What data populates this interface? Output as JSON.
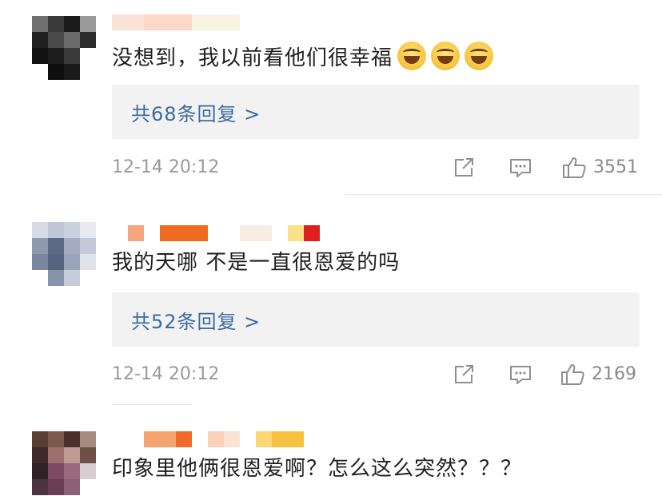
{
  "comments": [
    {
      "text": "没想到，我以前看他们很幸福",
      "emoji_icons": [
        "laughing-tears-icon",
        "laughing-tears-icon",
        "laughing-tears-icon"
      ],
      "replies_label": "共68条回复 >",
      "time": "12-14 20:12",
      "likes": "3551"
    },
    {
      "text": "我的天哪 不是一直很恩爱的吗",
      "emoji_icons": [],
      "replies_label": "共52条回复 >",
      "time": "12-14 20:12",
      "likes": "2169"
    },
    {
      "text": "印象里他俩很恩爱啊？怎么这么突然？？？",
      "emoji_icons": []
    }
  ],
  "icons": {
    "share": "share-icon",
    "comment": "comment-icon",
    "like": "thumbs-up-icon"
  },
  "colors": {
    "reply_link": "#3c6a9f",
    "reply_bg": "#f2f2f2",
    "meta_text": "#9a9a9a"
  }
}
